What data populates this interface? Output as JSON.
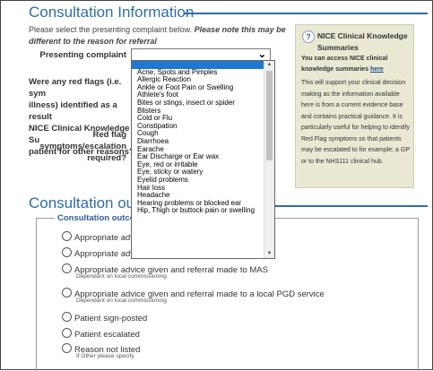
{
  "consultation_info": {
    "title": "Consultation Information",
    "intro_plain": "Please select the presenting complaint below. ",
    "intro_bold": "Please note",
    "intro_rest": " this may be different to the reason for referral",
    "presenting_label": "Presenting complaint",
    "presenting_value": "",
    "flags_lines": [
      "Were any red flags (i.e. sym",
      "illness) identified as a result",
      "NICE Clinical Knowledge Su",
      "patient for other reasons?"
    ],
    "redflag_lines": [
      "Red flag",
      "symptoms/escalation",
      "required?"
    ]
  },
  "nice_box": {
    "icon": "help-icon",
    "title": "NICE Clinical Knowledge Summaries",
    "lead": "You can access NICE clinical knowledge summaries ",
    "link": "here",
    "body": "This will support your clinical decision making as the information available here is from a current evidence base and contains practical guidance. It is particularly useful for helping to identify Red Flag symptoms so that patients may be escalated to for example; a GP or to the NHS111 clinical hub."
  },
  "outcome": {
    "title": "Consultation outcom",
    "legend": "Consultation outcor",
    "options": [
      {
        "label": "Appropriate advic",
        "note": ""
      },
      {
        "label": "Appropriate advic",
        "note": ""
      },
      {
        "label": "Appropriate advice given and referral made to MAS",
        "note": "Dependant on local commissioning"
      },
      {
        "label": "Appropriate advice given and referral made to a local PGD service",
        "note": "Dependant on local commissioning"
      },
      {
        "label": "Patient sign-posted",
        "note": ""
      },
      {
        "label": "Patient escalated",
        "note": ""
      },
      {
        "label": "Reason not listed",
        "note": "If Other please specify"
      }
    ]
  },
  "dropdown": {
    "items": [
      "",
      "Acne, Spots and Pimples",
      "Allergic Reaction",
      "Ankle or Foot Pain or Swelling",
      "Athlete's foot",
      "Bites or stings, insect or spider",
      "Blisters",
      "Cold or Flu",
      "Constipation",
      "Cough",
      "Diarrhoea",
      "Earache",
      "Ear Discharge or Ear wax",
      "Eye, red or irritable",
      "Eye, sticky or watery",
      "Eyelid problems",
      "Hair loss",
      "Headache",
      "Hearing problems or blocked ear",
      "Hip, Thigh or buttock pain or swelling"
    ],
    "selected_index": 0
  },
  "colors": {
    "heading": "#2e6da4",
    "selected": "#1e78d2",
    "info_box": "#e9e8d3"
  }
}
